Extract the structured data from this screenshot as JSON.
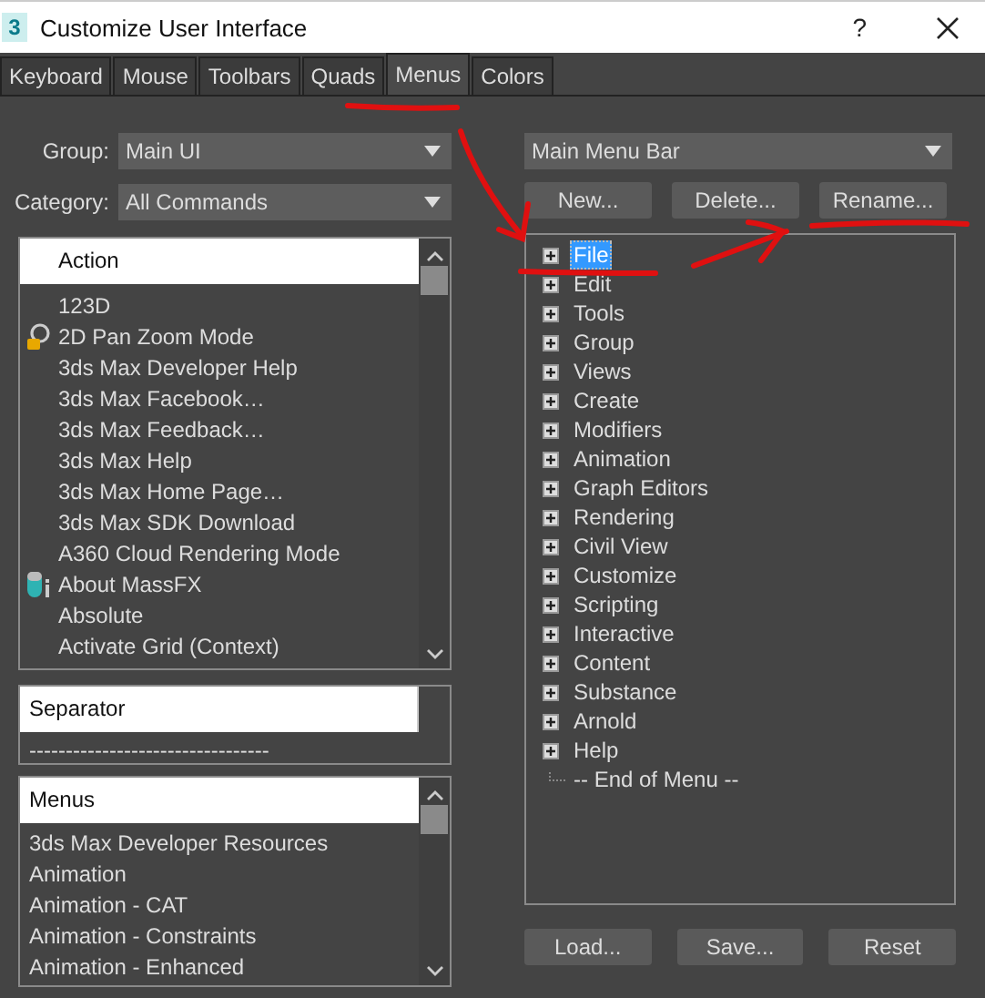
{
  "window": {
    "app_icon_text": "3",
    "title": "Customize User Interface",
    "help": "?"
  },
  "tabs": [
    {
      "label": "Keyboard",
      "selected": false
    },
    {
      "label": "Mouse",
      "selected": false
    },
    {
      "label": "Toolbars",
      "selected": false
    },
    {
      "label": "Quads",
      "selected": false
    },
    {
      "label": "Menus",
      "selected": true
    },
    {
      "label": "Colors",
      "selected": false
    }
  ],
  "group": {
    "label": "Group:",
    "value": "Main UI"
  },
  "category": {
    "label": "Category:",
    "value": "All Commands"
  },
  "action_list": {
    "header": "Action",
    "items": [
      {
        "label": "123D",
        "kind": "plain"
      },
      {
        "label": "2D Pan Zoom Mode",
        "kind": "zoom"
      },
      {
        "label": "3ds Max Developer Help",
        "kind": "plain"
      },
      {
        "label": "3ds Max Facebook…",
        "kind": "plain"
      },
      {
        "label": "3ds Max Feedback…",
        "kind": "plain"
      },
      {
        "label": "3ds Max Help",
        "kind": "plain"
      },
      {
        "label": "3ds Max Home Page…",
        "kind": "plain"
      },
      {
        "label": "3ds Max SDK Download",
        "kind": "plain"
      },
      {
        "label": "A360 Cloud Rendering Mode",
        "kind": "plain"
      },
      {
        "label": "About MassFX",
        "kind": "physics"
      },
      {
        "label": "Absolute",
        "kind": "plain"
      },
      {
        "label": "Activate Grid (Context)",
        "kind": "plain"
      }
    ]
  },
  "separator_list": {
    "header": "Separator",
    "items": [
      "---------------------------------"
    ]
  },
  "menus_list": {
    "header": "Menus",
    "items": [
      "3ds Max Developer Resources",
      "Animation",
      "Animation - CAT",
      "Animation - Constraints",
      "Animation - Enhanced"
    ]
  },
  "menu_select": {
    "value": "Main Menu Bar"
  },
  "menu_buttons": [
    "New...",
    "Delete...",
    "Rename..."
  ],
  "menu_tree": [
    {
      "label": "File",
      "expandable": true,
      "selected": true
    },
    {
      "label": "Edit",
      "expandable": true,
      "selected": false
    },
    {
      "label": "Tools",
      "expandable": true,
      "selected": false
    },
    {
      "label": "Group",
      "expandable": true,
      "selected": false
    },
    {
      "label": "Views",
      "expandable": true,
      "selected": false
    },
    {
      "label": "Create",
      "expandable": true,
      "selected": false
    },
    {
      "label": "Modifiers",
      "expandable": true,
      "selected": false
    },
    {
      "label": "Animation",
      "expandable": true,
      "selected": false
    },
    {
      "label": "Graph Editors",
      "expandable": true,
      "selected": false
    },
    {
      "label": "Rendering",
      "expandable": true,
      "selected": false
    },
    {
      "label": "Civil View",
      "expandable": true,
      "selected": false
    },
    {
      "label": "Customize",
      "expandable": true,
      "selected": false
    },
    {
      "label": "Scripting",
      "expandable": true,
      "selected": false
    },
    {
      "label": "Interactive",
      "expandable": true,
      "selected": false
    },
    {
      "label": "Content",
      "expandable": true,
      "selected": false
    },
    {
      "label": "Substance",
      "expandable": true,
      "selected": false
    },
    {
      "label": "Arnold",
      "expandable": true,
      "selected": false
    },
    {
      "label": "Help",
      "expandable": true,
      "selected": false
    },
    {
      "label": "-- End of Menu --",
      "expandable": false,
      "selected": false
    }
  ],
  "bottom_buttons": [
    "Load...",
    "Save...",
    "Reset"
  ]
}
